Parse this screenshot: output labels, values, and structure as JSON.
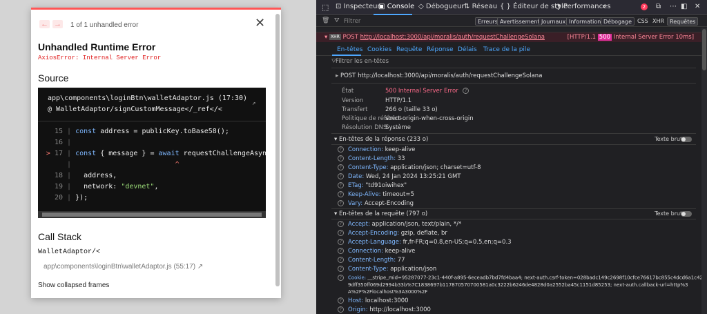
{
  "modal": {
    "counter": "1 of 1 unhandled error",
    "title": "Unhandled Runtime Error",
    "subtitle": "AxiosError: Internal Server Error",
    "source_heading": "Source",
    "source_file_line1": "app\\components\\loginBtn\\walletAdaptor.js (17:30)",
    "source_file_line2": "@ WalletAdaptor/signCustomMessage</_ref</<",
    "code": [
      {
        "num": "15",
        "marker": "",
        "text": "const address = publicKey.toBase58();"
      },
      {
        "num": "16",
        "marker": "",
        "text": ""
      },
      {
        "num": "17",
        "marker": ">",
        "text": "const { message } = await requestChallengeAsync"
      },
      {
        "num": "",
        "marker": "",
        "text": "^"
      },
      {
        "num": "18",
        "marker": "",
        "text": "address,"
      },
      {
        "num": "19",
        "marker": "",
        "text": "network: \"devnet\","
      },
      {
        "num": "20",
        "marker": "",
        "text": "});"
      }
    ],
    "callstack_heading": "Call Stack",
    "callstack_fn": "WalletAdaptor/<",
    "callstack_loc": "app\\components\\loginBtn\\walletAdaptor.js (55:17)",
    "show_collapsed": "Show collapsed frames"
  },
  "devtools": {
    "tabs": [
      "Inspecteur",
      "Console",
      "Débogueur",
      "Réseau",
      "Éditeur de style",
      "Performances"
    ],
    "active_tab": "Console",
    "error_count": "2",
    "filter_placeholder": "Filtrer",
    "filter_buttons": [
      "Erreurs",
      "Avertissements",
      "Journaux",
      "Informations",
      "Débogage",
      "CSS",
      "XHR",
      "Requêtes"
    ],
    "request": {
      "type": "XHR",
      "method": "POST",
      "url": "http://localhost:3000/api/moralis/auth/requestChallengeSolana",
      "status_prefix": "[HTTP/1.1",
      "status_code": "500",
      "status_suffix": "Internal Server Error 10ms]"
    },
    "detail_tabs": [
      "En-têtes",
      "Cookies",
      "Requête",
      "Réponse",
      "Délais",
      "Trace de la pile"
    ],
    "header_filter": "Filtrer les en-têtes",
    "summary_line": "POST  http://localhost:3000/api/moralis/auth/requestChallengeSolana",
    "summary": [
      {
        "label": "État",
        "value": "500 Internal Server Error"
      },
      {
        "label": "Version",
        "value": "HTTP/1.1"
      },
      {
        "label": "Transfert",
        "value": "266 o (taille 33 o)"
      },
      {
        "label": "Politique de référent",
        "value": "strict-origin-when-cross-origin"
      },
      {
        "label": "Résolution DNS",
        "value": "Système"
      }
    ],
    "response_headers_title": "En-têtes de la réponse (233 o)",
    "raw_label": "Texte brut",
    "response_headers": [
      {
        "name": "Connection:",
        "value": "keep-alive"
      },
      {
        "name": "Content-Length:",
        "value": "33"
      },
      {
        "name": "Content-Type:",
        "value": "application/json; charset=utf-8"
      },
      {
        "name": "Date:",
        "value": "Wed, 24 Jan 2024 13:25:21 GMT"
      },
      {
        "name": "ETag:",
        "value": "\"td91oiwihex\""
      },
      {
        "name": "Keep-Alive:",
        "value": "timeout=5"
      },
      {
        "name": "Vary:",
        "value": "Accept-Encoding"
      }
    ],
    "request_headers_title": "En-têtes de la requête (797 o)",
    "request_headers": [
      {
        "name": "Accept:",
        "value": "application/json, text/plain, */*"
      },
      {
        "name": "Accept-Encoding:",
        "value": "gzip, deflate, br"
      },
      {
        "name": "Accept-Language:",
        "value": "fr,fr-FR;q=0.8,en-US;q=0.5,en;q=0.3"
      },
      {
        "name": "Connection:",
        "value": "keep-alive"
      },
      {
        "name": "Content-Length:",
        "value": "77"
      },
      {
        "name": "Content-Type:",
        "value": "application/json"
      },
      {
        "name": "Cookie:",
        "value": "__stripe_mid=95287077-23c1-440f-a895-6eceadb7bd7fd4baa4; next-auth.csrf-token=028badc149c2698f10cfce76617bc855c4dcd6a1c42"
      },
      {
        "name": "",
        "value": "9dff350ff069d2994b33b%7C1838697b117870570700581a0c3222b6246de4828d0a2552ba45c1151d85253; next-auth.callback-url=http%3"
      },
      {
        "name": "",
        "value": "A%2F%2Flocalhost%3A3000%2F"
      },
      {
        "name": "Host:",
        "value": "localhost:3000"
      },
      {
        "name": "Origin:",
        "value": "http://localhost:3000"
      }
    ]
  }
}
